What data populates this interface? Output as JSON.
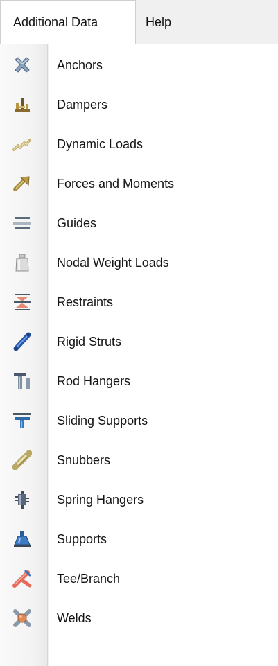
{
  "menubar": {
    "active_menu": "Additional Data",
    "help_menu": "Help"
  },
  "menu": {
    "items": [
      {
        "label": "Anchors",
        "icon": "anchor-icon"
      },
      {
        "label": "Dampers",
        "icon": "damper-icon"
      },
      {
        "label": "Dynamic Loads",
        "icon": "dynamic-loads-icon"
      },
      {
        "label": "Forces and Moments",
        "icon": "forces-moments-icon"
      },
      {
        "label": "Guides",
        "icon": "guide-icon"
      },
      {
        "label": "Nodal Weight Loads",
        "icon": "weight-icon"
      },
      {
        "label": "Restraints",
        "icon": "restraint-icon"
      },
      {
        "label": "Rigid Struts",
        "icon": "rigid-strut-icon"
      },
      {
        "label": "Rod Hangers",
        "icon": "rod-hanger-icon"
      },
      {
        "label": "Sliding Supports",
        "icon": "sliding-support-icon"
      },
      {
        "label": "Snubbers",
        "icon": "snubber-icon"
      },
      {
        "label": "Spring Hangers",
        "icon": "spring-hanger-icon"
      },
      {
        "label": "Supports",
        "icon": "support-icon"
      },
      {
        "label": "Tee/Branch",
        "icon": "tee-branch-icon"
      },
      {
        "label": "Welds",
        "icon": "weld-icon"
      }
    ]
  },
  "colors": {
    "menubar_bg": "#f0f0f0",
    "gutter_bg": "#f3f3f3",
    "text": "#141414"
  }
}
